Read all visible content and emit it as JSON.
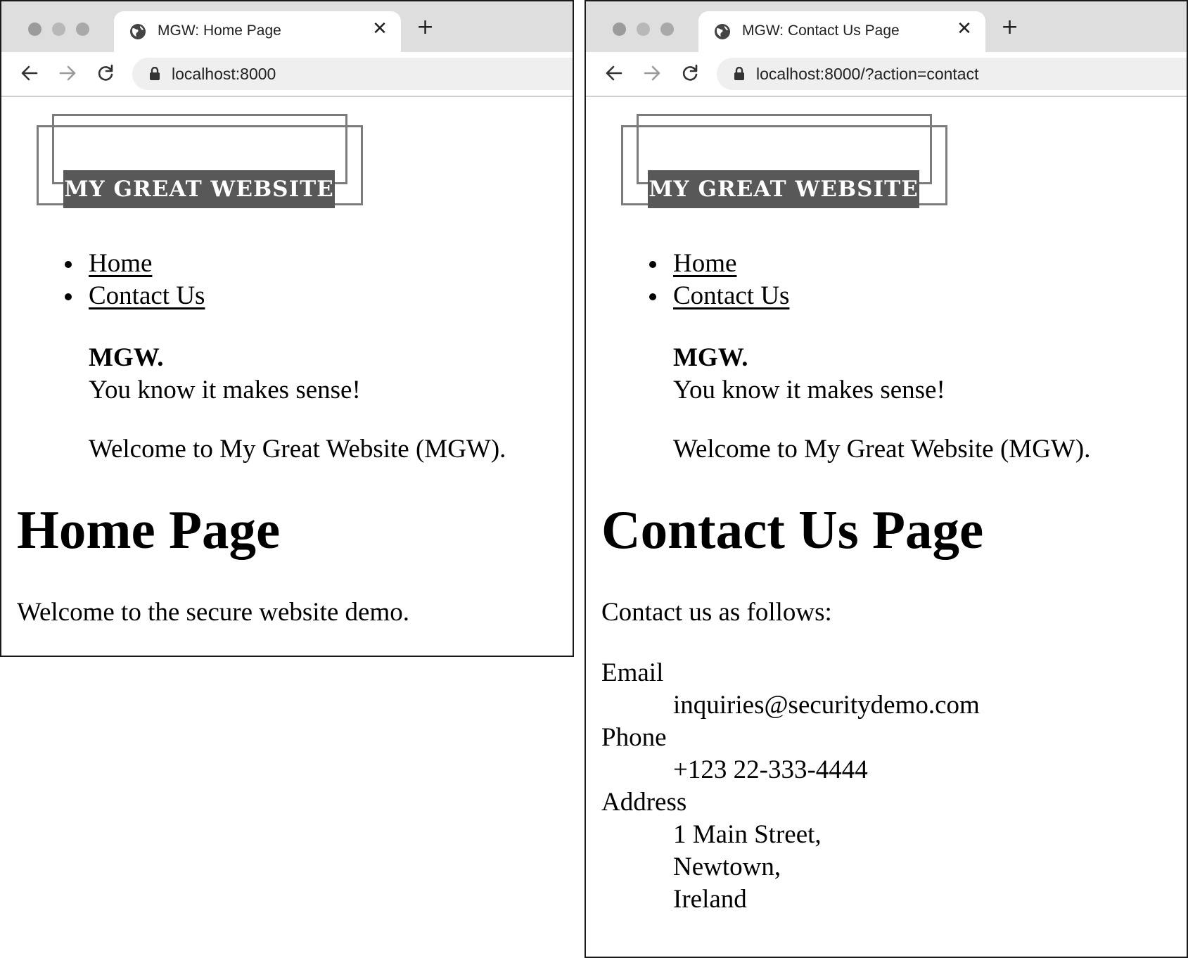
{
  "windows": {
    "left": {
      "tab_title": "MGW: Home Page",
      "tab_close": "✕",
      "new_tab": "+",
      "url": "localhost:8000",
      "logo_text": "MY GREAT WEBSITE",
      "nav": [
        "Home",
        "Contact Us"
      ],
      "tagline_brand": "MGW.",
      "tagline_text": "You know it makes sense!",
      "welcome": "Welcome to My Great Website (MGW).",
      "heading": "Home Page",
      "body_text": "Welcome to the secure website demo."
    },
    "right": {
      "tab_title": "MGW: Contact Us Page",
      "tab_close": "✕",
      "new_tab": "+",
      "url": "localhost:8000/?action=contact",
      "logo_text": "MY GREAT WEBSITE",
      "nav": [
        "Home",
        "Contact Us"
      ],
      "tagline_brand": "MGW.",
      "tagline_text": "You know it makes sense!",
      "welcome": "Welcome to My Great Website (MGW).",
      "heading": "Contact Us Page",
      "body_text": "Contact us as follows:",
      "contact": {
        "email_label": "Email",
        "email_value": "inquiries@securitydemo.com",
        "phone_label": "Phone",
        "phone_value": "+123 22-333-4444",
        "address_label": "Address",
        "address_lines": [
          "1 Main Street,",
          "Newtown,",
          "Ireland"
        ]
      }
    }
  },
  "icons": {
    "tab": "globe-icon",
    "back": "arrow-left-icon",
    "forward": "arrow-right-icon",
    "reload": "reload-icon",
    "lock": "lock-icon"
  },
  "colors": {
    "tabbar": "#dedede",
    "omnibox": "#efefef",
    "logo_plate": "#585858",
    "logo_frame": "#7c7c7c"
  }
}
